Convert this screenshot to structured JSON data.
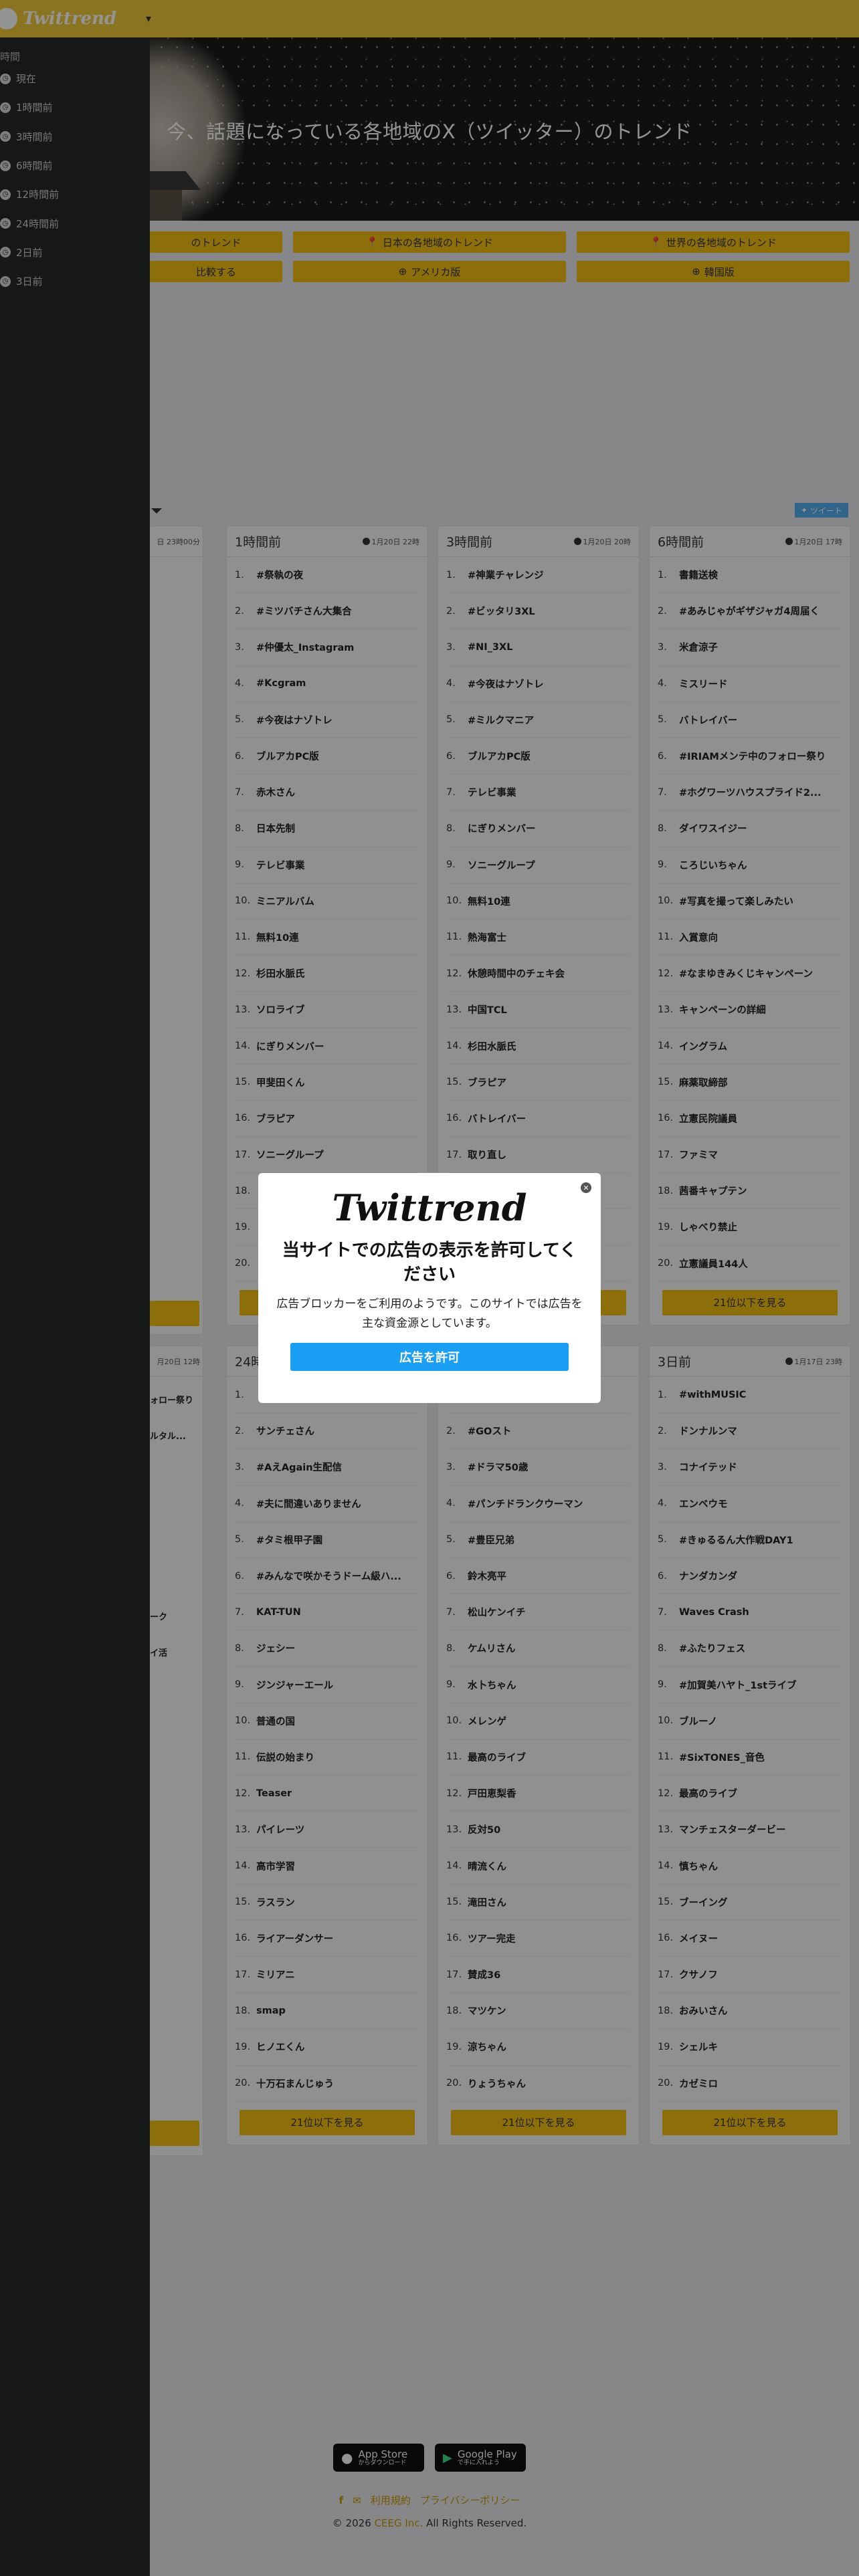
{
  "header": {
    "brand": "Twittrend"
  },
  "hero": {
    "title": "今、話題になっている各地域のX（ツイッター）のトレンド"
  },
  "nav": {
    "row1": [
      "のトレンド",
      "日本の各地域のトレンド",
      "世界の各地域のトレンド"
    ],
    "row2": [
      "比較する",
      "アメリカ版",
      "韓国版"
    ]
  },
  "sidebar": {
    "head": "時間",
    "items": [
      "現在",
      "1時間前",
      "3時間前",
      "6時間前",
      "12時間前",
      "24時間前",
      "2日前",
      "3日前"
    ]
  },
  "tweet_label": "ツイート",
  "columns": [
    {
      "title": "1時間前",
      "date": "1月20日 22時",
      "more": "21位以下を見る",
      "items": [
        "#祭執の夜",
        "#ミツバチさん大集合",
        "#仲優太_Instagram",
        "#Kcgram",
        "#今夜はナゾトレ",
        "ブルアカPC版",
        "赤木さん",
        "日本先制",
        "テレビ事業",
        "ミニアルバム",
        "無料10連",
        "杉田水脈氏",
        "ソロライブ",
        "にぎりメンバー",
        "甲斐田くん",
        "ブラピア",
        "ソニーグループ",
        "",
        "",
        ""
      ]
    },
    {
      "title": "3時間前",
      "date": "1月20日 20時",
      "more": "21位以下を見る",
      "items": [
        "#神業チャレンジ",
        "#ビッタリ3XL",
        "#NI_3XL",
        "#今夜はナゾトレ",
        "#ミルクマニア",
        "ブルアカPC版",
        "テレビ事業",
        "にぎりメンバー",
        "ソニーグループ",
        "無料10連",
        "熱海富士",
        "休憩時間中のチェキ会",
        "中国TCL",
        "杉田水脈氏",
        "ブラピア",
        "バトレイバー",
        "取り直し",
        "",
        "",
        ""
      ]
    },
    {
      "title": "6時間前",
      "date": "1月20日 17時",
      "more": "21位以下を見る",
      "items": [
        "書籍送検",
        "#あみじゃがギザジャガ4周届く",
        "米倉涼子",
        "ミスリード",
        "バトレイバー",
        "#IRIAMメンテ中のフォロー祭り",
        "#ホグワーツハウスプライド2...",
        "ダイワスイジー",
        "ころじいちゃん",
        "#写真を撮って楽しみたい",
        "入賞意向",
        "#なまゆきみくじキャンペーン",
        "キャンペーンの詳細",
        "イングラム",
        "麻薬取締部",
        "立憲民院議員",
        "ファミマ",
        "茜番キャプテン",
        "しゃべり禁止",
        "立憲議員144人"
      ]
    },
    {
      "title": "24時間前",
      "date": "",
      "more": "21位以下を見る",
      "items": [
        "",
        "サンチェさん",
        "#AえAgain生配信",
        "#夫に間違いありません",
        "#タミ根甲子園",
        "#みんなで咲かそうドーム級ハ...",
        "KAT-TUN",
        "ジェシー",
        "ジンジャーエール",
        "普通の国",
        "伝説の始まり",
        "Teaser",
        "パイレーツ",
        "高市学習",
        "ラスラン",
        "ライアーダンサー",
        "ミリアニ",
        "smap",
        "ヒノエくん",
        "十万石まんじゅう"
      ]
    },
    {
      "title": "",
      "date": "",
      "more": "21位以下を見る",
      "items": [
        "",
        "#GOスト",
        "#ドラマ50歳",
        "#パンチドランクウーマン",
        "#豊臣兄弟",
        "鈴木亮平",
        "松山ケンイチ",
        "ケムリさん",
        "水卜ちゃん",
        "メレンゲ",
        "最高のライブ",
        "戸田恵梨香",
        "反対50",
        "晴流くん",
        "滝田さん",
        "ツアー完走",
        "賛成36",
        "マツケン",
        "涼ちゃん",
        "りょうちゃん"
      ]
    },
    {
      "title": "3日前",
      "date": "1月17日 23時",
      "more": "21位以下を見る",
      "items": [
        "#withMUSIC",
        "ドンナルンマ",
        "コナイテッド",
        "エンベウモ",
        "#きゅるるん大作戦DAY1",
        "ナンダカンダ",
        "Waves Crash",
        "#ふたりフェス",
        "#加賀美ハヤト_1stライブ",
        "ブルーノ",
        "#SixTONES_音色",
        "最高のライブ",
        "マンチェスターダービー",
        "慎ちゃん",
        "ブーイング",
        "メイヌー",
        "クサノフ",
        "おみいさん",
        "シェルキ",
        "カゼミロ"
      ]
    }
  ],
  "partial_left": {
    "top_date": "日 23時00分",
    "bottom_date": "月20日 12時",
    "bottom_items": [
      "ォロー祭り",
      "ルタル...",
      "ーク",
      "イ活"
    ]
  },
  "footer": {
    "appstore_big": "App Store",
    "appstore_small": "からダウンロード",
    "googleplay_big": "Google Play",
    "googleplay_small": "で手に入れよう",
    "terms": "利用規約",
    "privacy": "プライバシーポリシー",
    "copyright_prefix": "© 2026",
    "company": "CEEG Inc.",
    "copyright_suffix": "All Rights Reserved."
  },
  "modal": {
    "logo": "Twittrend",
    "title": "当サイトでの広告の表示を許可してください",
    "body": "広告ブロッカーをご利用のようです。このサイトでは広告を主な資金源としています。",
    "button": "広告を許可"
  }
}
